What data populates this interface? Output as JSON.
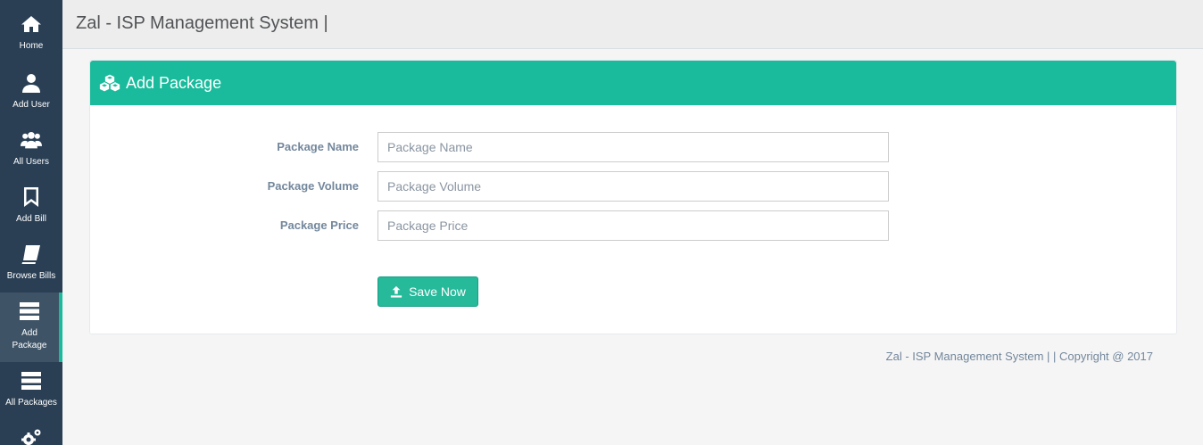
{
  "sidebar": {
    "items": [
      {
        "label": "Home",
        "icon": "home-icon"
      },
      {
        "label": "Add User",
        "icon": "user-icon"
      },
      {
        "label": "All Users",
        "icon": "users-icon"
      },
      {
        "label": "Add Bill",
        "icon": "bookmark-icon"
      },
      {
        "label": "Browse Bills",
        "icon": "book-icon"
      },
      {
        "label": "Add\nPackage",
        "icon": "server-icon",
        "active": true
      },
      {
        "label": "All Packages",
        "icon": "server-icon"
      },
      {
        "label": "",
        "icon": "gears-icon"
      }
    ],
    "bg_color": "#2a3f54",
    "active_accent": "#1abb9c"
  },
  "header": {
    "title": "Zal - ISP Management System |"
  },
  "panel": {
    "title": "Add Package",
    "icon": "cubes-icon",
    "header_color": "#1abb9c",
    "fields": [
      {
        "label": "Package Name",
        "placeholder": "Package Name",
        "value": ""
      },
      {
        "label": "Package Volume",
        "placeholder": "Package Volume",
        "value": ""
      },
      {
        "label": "Package Price",
        "placeholder": "Package Price",
        "value": ""
      }
    ],
    "save_label": "Save Now",
    "save_icon": "upload-icon",
    "button_color": "#26b99a"
  },
  "footer": {
    "text": "Zal - ISP Management System | | Copyright @ 2017"
  }
}
